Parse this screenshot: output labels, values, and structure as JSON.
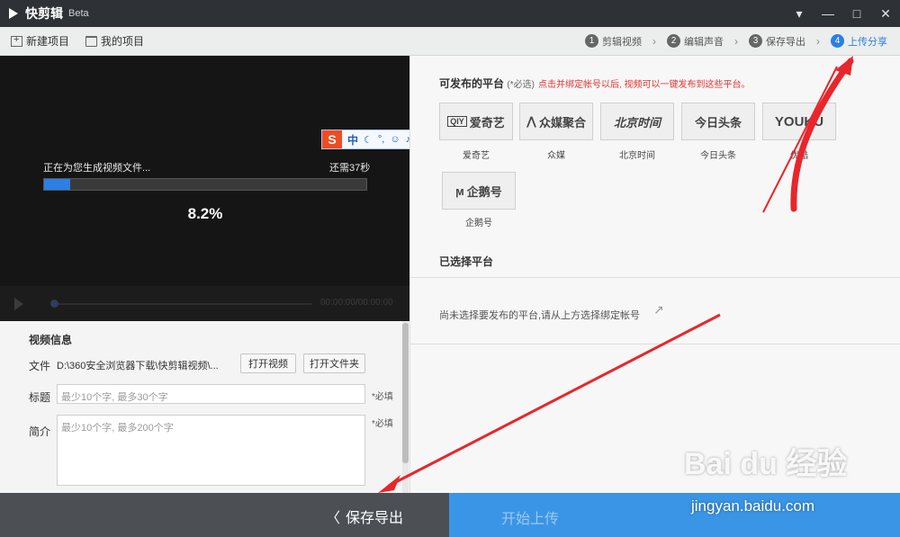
{
  "titlebar": {
    "app_name": "快剪辑",
    "badge": "Beta",
    "controls": [
      "▾",
      "—",
      "□",
      "✕"
    ]
  },
  "toolbar": {
    "new_project": "新建项目",
    "my_projects": "我的项目",
    "steps": [
      {
        "num": "1",
        "label": "剪辑视频"
      },
      {
        "num": "2",
        "label": "编辑声音"
      },
      {
        "num": "3",
        "label": "保存导出"
      },
      {
        "num": "4",
        "label": "上传分享",
        "active": true
      }
    ]
  },
  "export": {
    "status_text": "正在为您生成视频文件...",
    "remaining_text": "还需37秒",
    "percent_text": "8.2%",
    "progress_fraction": 0.082,
    "time_display": "00:00:00/00:00:00"
  },
  "ime": {
    "logo": "S",
    "mode": "中"
  },
  "video_info": {
    "section_title": "视频信息",
    "file_label": "文件",
    "file_path": "D:\\360安全浏览器下载\\快剪辑视频\\...",
    "open_video": "打开视频",
    "open_folder": "打开文件夹",
    "title_label": "标题",
    "title_placeholder": "最少10个字, 最多30个字",
    "required": "*必填",
    "desc_label": "简介",
    "desc_placeholder": "最少10个字, 最多200个字"
  },
  "platforms": {
    "section_title": "可发布的平台",
    "optional": "(*必选)",
    "note": "点击并绑定帐号以后, 视频可以一键发布到这些平台。",
    "items": [
      {
        "logo": "爱奇艺",
        "logo_prefix": "QIY",
        "name": "爱奇艺"
      },
      {
        "logo": "众媒聚合",
        "logo_prefix": "",
        "name": "众媒"
      },
      {
        "logo": "北京时间",
        "logo_prefix": "",
        "name": "北京时间"
      },
      {
        "logo": "今日头条",
        "logo_prefix": "",
        "name": "今日头条"
      },
      {
        "logo": "YOUKU",
        "logo_prefix": "",
        "name": "优酷"
      },
      {
        "logo": "企鹅号",
        "logo_prefix": "",
        "name": "企鹅号"
      }
    ],
    "selected_title": "已选择平台",
    "empty_text": "尚未选择要发布的平台,请从上方选择绑定帐号"
  },
  "bottom": {
    "save_export": "保存导出",
    "start_upload": "开始上传"
  },
  "watermark": {
    "brand": "Bai du 经验",
    "url": "jingyan.baidu.com"
  },
  "colors": {
    "accent": "#2b7fe5",
    "required_note": "#e53333",
    "annotation_arrow": "#e8262b",
    "upload_bg": "#3a95e6",
    "bottom_dark": "#4c5055"
  }
}
